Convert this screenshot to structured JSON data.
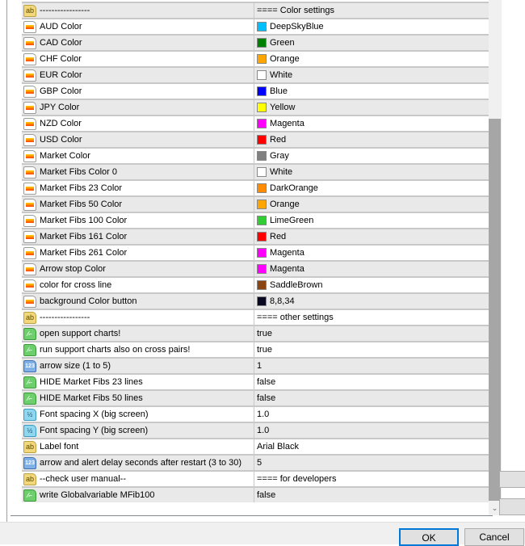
{
  "rows": [
    {
      "type": "ab",
      "name": "-----------------",
      "value": "==== Color settings"
    },
    {
      "type": "color",
      "name": "AUD Color",
      "value": "DeepSkyBlue",
      "swatch": "#00bfff"
    },
    {
      "type": "color",
      "name": "CAD Color",
      "value": "Green",
      "swatch": "#008000"
    },
    {
      "type": "color",
      "name": "CHF Color",
      "value": "Orange",
      "swatch": "#ffa500"
    },
    {
      "type": "color",
      "name": "EUR Color",
      "value": "White",
      "swatch": "#ffffff"
    },
    {
      "type": "color",
      "name": "GBP Color",
      "value": "Blue",
      "swatch": "#0000ff"
    },
    {
      "type": "color",
      "name": "JPY Color",
      "value": "Yellow",
      "swatch": "#ffff00"
    },
    {
      "type": "color",
      "name": "NZD Color",
      "value": "Magenta",
      "swatch": "#ff00ff"
    },
    {
      "type": "color",
      "name": "USD Color",
      "value": "Red",
      "swatch": "#ff0000"
    },
    {
      "type": "color",
      "name": "Market Color",
      "value": "Gray",
      "swatch": "#808080"
    },
    {
      "type": "color",
      "name": "Market Fibs Color 0",
      "value": "White",
      "swatch": "#ffffff"
    },
    {
      "type": "color",
      "name": "Market Fibs 23 Color",
      "value": "DarkOrange",
      "swatch": "#ff8c00"
    },
    {
      "type": "color",
      "name": "Market Fibs 50 Color",
      "value": "Orange",
      "swatch": "#ffa500"
    },
    {
      "type": "color",
      "name": "Market Fibs 100 Color",
      "value": "LimeGreen",
      "swatch": "#32cd32"
    },
    {
      "type": "color",
      "name": "Market Fibs 161 Color",
      "value": "Red",
      "swatch": "#ff0000"
    },
    {
      "type": "color",
      "name": "Market Fibs 261 Color",
      "value": "Magenta",
      "swatch": "#ff00ff"
    },
    {
      "type": "color",
      "name": "Arrow stop Color",
      "value": "Magenta",
      "swatch": "#ff00ff"
    },
    {
      "type": "color",
      "name": "color for cross line",
      "value": "SaddleBrown",
      "swatch": "#8b4513"
    },
    {
      "type": "color",
      "name": "background Color button",
      "value": "8,8,34",
      "swatch": "#080822"
    },
    {
      "type": "ab",
      "name": "-----------------",
      "value": "==== other settings"
    },
    {
      "type": "bool",
      "name": "open support charts!",
      "value": "true"
    },
    {
      "type": "bool",
      "name": "run support charts also on cross pairs!",
      "value": "true"
    },
    {
      "type": "int",
      "name": "arrow size (1 to 5)",
      "value": "1"
    },
    {
      "type": "bool",
      "name": "HIDE Market Fibs 23 lines",
      "value": "false"
    },
    {
      "type": "bool",
      "name": "HIDE Market Fibs 50 lines",
      "value": "false"
    },
    {
      "type": "dbl",
      "name": "Font spacing X (big screen)",
      "value": "1.0"
    },
    {
      "type": "dbl",
      "name": "Font spacing Y (big screen)",
      "value": "1.0"
    },
    {
      "type": "ab",
      "name": "Label font",
      "value": "Arial Black"
    },
    {
      "type": "int",
      "name": "arrow and alert delay seconds after restart (3 to 30)",
      "value": "5"
    },
    {
      "type": "ab",
      "name": "--check user manual--",
      "value": "==== for developers"
    },
    {
      "type": "bool",
      "name": "write Globalvariable MFib100",
      "value": "false"
    }
  ],
  "icons": {
    "ab": "ab",
    "bool": "⁄⌐",
    "int": "123",
    "dbl": "½",
    "color": ""
  },
  "buttons": {
    "ok": "OK",
    "cancel": "Cancel"
  }
}
